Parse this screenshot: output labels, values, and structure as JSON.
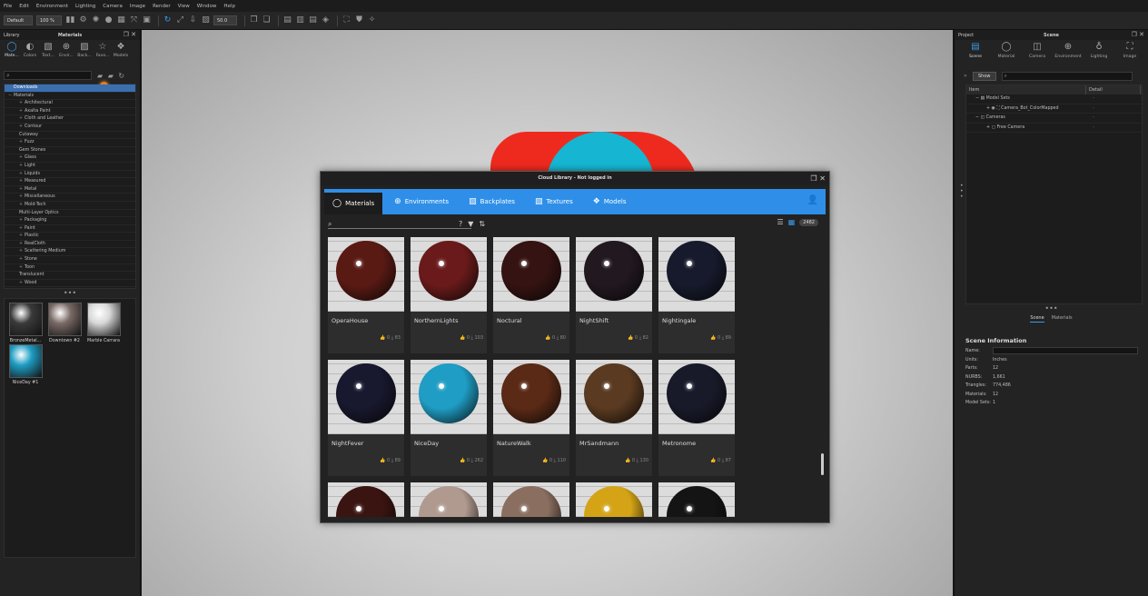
{
  "menubar": [
    "File",
    "Edit",
    "Environment",
    "Lighting",
    "Camera",
    "Image",
    "Render",
    "View",
    "Window",
    "Help"
  ],
  "toolbar": {
    "preset": "Default",
    "zoom": "100 %",
    "fov": "50.0"
  },
  "library": {
    "header_left": "Library",
    "header_center": "Materials",
    "tabs": [
      {
        "label": "Mate...",
        "icon": "sphere-icon"
      },
      {
        "label": "Colors",
        "icon": "palette-icon"
      },
      {
        "label": "Text...",
        "icon": "texture-icon"
      },
      {
        "label": "Envir...",
        "icon": "globe-icon"
      },
      {
        "label": "Back...",
        "icon": "image-icon"
      },
      {
        "label": "Favo...",
        "icon": "star-icon"
      },
      {
        "label": "Models",
        "icon": "models-icon"
      }
    ],
    "search_glyph": "⌕",
    "tree": [
      {
        "label": "Downloads",
        "selected": true,
        "indent": 1
      },
      {
        "label": "Materials",
        "indent": 0,
        "exp": "−"
      },
      {
        "label": "Architectural",
        "indent": 2,
        "exp": "+"
      },
      {
        "label": "Axalta Paint",
        "indent": 2,
        "exp": "+"
      },
      {
        "label": "Cloth and Leather",
        "indent": 2,
        "exp": "+"
      },
      {
        "label": "Contour",
        "indent": 2,
        "exp": "+"
      },
      {
        "label": "Cutaway",
        "indent": 2,
        "exp": ""
      },
      {
        "label": "Fuzz",
        "indent": 2,
        "exp": "+"
      },
      {
        "label": "Gem Stones",
        "indent": 2,
        "exp": ""
      },
      {
        "label": "Glass",
        "indent": 2,
        "exp": "+"
      },
      {
        "label": "Light",
        "indent": 2,
        "exp": "+"
      },
      {
        "label": "Liquids",
        "indent": 2,
        "exp": "+"
      },
      {
        "label": "Measured",
        "indent": 2,
        "exp": "+"
      },
      {
        "label": "Metal",
        "indent": 2,
        "exp": "+"
      },
      {
        "label": "Miscellaneous",
        "indent": 2,
        "exp": "+"
      },
      {
        "label": "Mold-Tech",
        "indent": 2,
        "exp": "+"
      },
      {
        "label": "Multi-Layer Optics",
        "indent": 2,
        "exp": ""
      },
      {
        "label": "Packaging",
        "indent": 2,
        "exp": "+"
      },
      {
        "label": "Paint",
        "indent": 2,
        "exp": "+"
      },
      {
        "label": "Plastic",
        "indent": 2,
        "exp": "+"
      },
      {
        "label": "RealCloth",
        "indent": 2,
        "exp": "+"
      },
      {
        "label": "Scattering Medium",
        "indent": 2,
        "exp": "+"
      },
      {
        "label": "Stone",
        "indent": 2,
        "exp": "+"
      },
      {
        "label": "Toon",
        "indent": 2,
        "exp": "+"
      },
      {
        "label": "Translucent",
        "indent": 2,
        "exp": ""
      },
      {
        "label": "Wood",
        "indent": 2,
        "exp": "+"
      }
    ],
    "thumbs": [
      {
        "label": "BronzeMetal...",
        "color": "#3a3a3a"
      },
      {
        "label": "Downtown #2",
        "color": "#7a6a66"
      },
      {
        "label": "Marble Carrara",
        "color": "#d8d8d8"
      },
      {
        "label": "NiceDay #1",
        "color": "#1f9dc4"
      }
    ]
  },
  "dialog": {
    "title": "Cloud Library - Not logged in",
    "tabs": [
      {
        "label": "Materials",
        "icon": "sphere-icon",
        "active": true
      },
      {
        "label": "Environments",
        "icon": "globe-icon"
      },
      {
        "label": "Backplates",
        "icon": "image-icon"
      },
      {
        "label": "Textures",
        "icon": "texture-icon"
      },
      {
        "label": "Models",
        "icon": "models-icon"
      }
    ],
    "result_count": "2482",
    "materials": [
      {
        "name": "OperaHouse",
        "likes": "0",
        "downloads": "83",
        "color": "#5a1a14"
      },
      {
        "name": "NorthernLights",
        "likes": "0",
        "downloads": "103",
        "color": "#6a1a1a"
      },
      {
        "name": "Noctural",
        "likes": "0",
        "downloads": "80",
        "color": "#351312"
      },
      {
        "name": "NightShift",
        "likes": "0",
        "downloads": "82",
        "color": "#221820"
      },
      {
        "name": "Nightingale",
        "likes": "0",
        "downloads": "89",
        "color": "#161a2c"
      },
      {
        "name": "NightFever",
        "likes": "0",
        "downloads": "89",
        "color": "#18182e"
      },
      {
        "name": "NiceDay",
        "likes": "0",
        "downloads": "262",
        "color": "#1f9dc4"
      },
      {
        "name": "NatureWalk",
        "likes": "0",
        "downloads": "110",
        "color": "#5a2a16"
      },
      {
        "name": "MrSandmann",
        "likes": "0",
        "downloads": "130",
        "color": "#5a3a20"
      },
      {
        "name": "Metronome",
        "likes": "0",
        "downloads": "87",
        "color": "#181a2a"
      },
      {
        "name": "",
        "likes": "",
        "downloads": "",
        "color": "#3a1410"
      },
      {
        "name": "",
        "likes": "",
        "downloads": "",
        "color": "#b09a90"
      },
      {
        "name": "",
        "likes": "",
        "downloads": "",
        "color": "#8a6e60"
      },
      {
        "name": "",
        "likes": "",
        "downloads": "",
        "color": "#d4a416"
      },
      {
        "name": "",
        "likes": "",
        "downloads": "",
        "color": "#141414"
      }
    ]
  },
  "project": {
    "header_left": "Project",
    "header_center": "Scene",
    "tabs": [
      {
        "label": "Scene",
        "icon": "scene-icon",
        "active": true
      },
      {
        "label": "Material",
        "icon": "sphere-icon"
      },
      {
        "label": "Camera",
        "icon": "camera-icon"
      },
      {
        "label": "Environment",
        "icon": "globe-icon"
      },
      {
        "label": "Lighting",
        "icon": "bulb-icon"
      },
      {
        "label": "Image",
        "icon": "crop-icon"
      }
    ],
    "show_label": "Show",
    "col_item": "Item",
    "col_detail": "Detail",
    "tree": [
      {
        "label": "Model Sets",
        "indent": 1
      },
      {
        "label": "Camera_Bot_ColorMapped",
        "indent": 3
      },
      {
        "label": "Cameras",
        "indent": 1
      },
      {
        "label": "Free Camera",
        "indent": 3
      }
    ],
    "subtabs": [
      "Scene",
      "Materials"
    ],
    "info_title": "Scene Information",
    "info": [
      {
        "k": "Name:",
        "v": ""
      },
      {
        "k": "Units:",
        "v": "Inches"
      },
      {
        "k": "Parts:",
        "v": "12"
      },
      {
        "k": "NURBS:",
        "v": "1,661"
      },
      {
        "k": "Triangles:",
        "v": "774,486"
      },
      {
        "k": "Materials:",
        "v": "12"
      },
      {
        "k": "Model Sets:",
        "v": "1"
      }
    ]
  }
}
